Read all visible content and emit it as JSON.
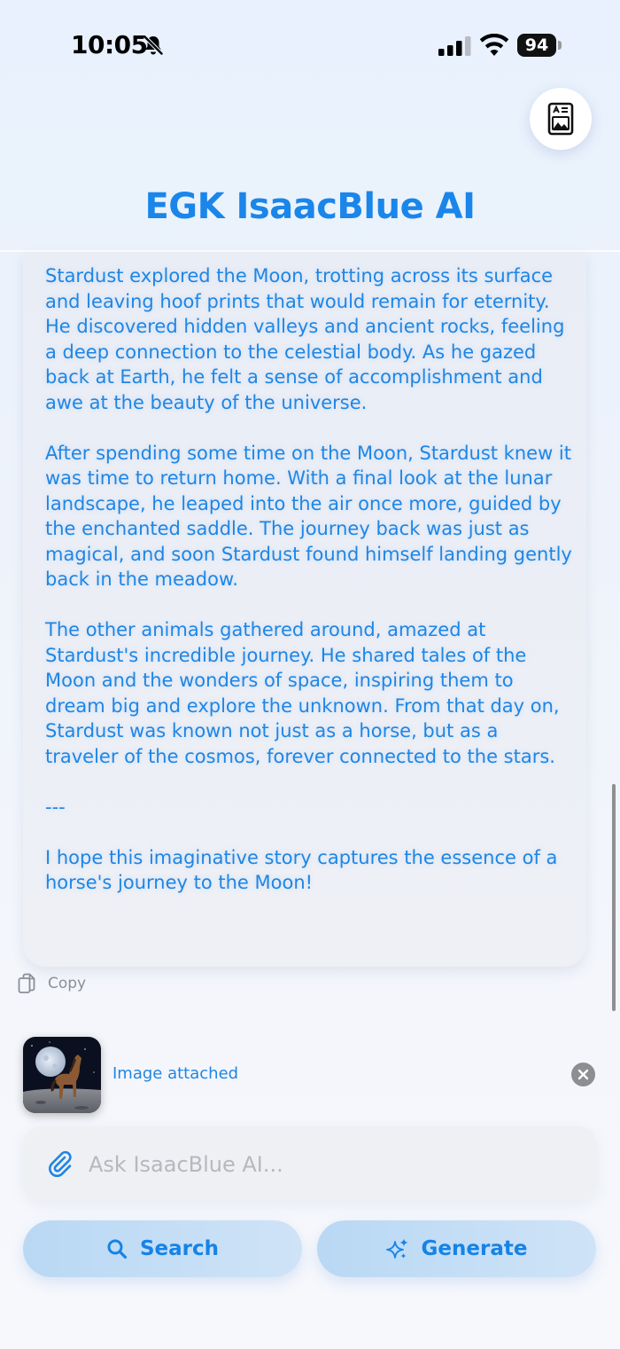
{
  "status_bar": {
    "time": "10:05",
    "battery": "94"
  },
  "header": {
    "title": "EGK IsaacBlue AI",
    "gallery_icon": "image-document-icon"
  },
  "message": {
    "paragraphs": [
      "Stardust explored the Moon, trotting across its surface and leaving hoof prints that would remain for eternity. He discovered hidden valleys and ancient rocks, feeling a deep connection to the celestial body. As he gazed back at Earth, he felt a sense of accomplishment and awe at the beauty of the universe.",
      "After spending some time on the Moon, Stardust knew it was time to return home. With a final look at the lunar landscape, he leaped into the air once more, guided by the enchanted saddle. The journey back was just as magical, and soon Stardust found himself landing gently back in the meadow.",
      "The other animals gathered around, amazed at Stardust's incredible journey. He shared tales of the Moon and the wonders of space, inspiring them to dream big and explore the unknown. From that day on, Stardust was known not just as a horse, but as a traveler of the cosmos, forever connected to the stars.",
      "---",
      "I hope this imaginative story captures the essence of a horse's journey to the Moon!"
    ],
    "copy_label": "Copy"
  },
  "attachment": {
    "label": "Image attached"
  },
  "input": {
    "placeholder": "Ask IsaacBlue AI..."
  },
  "actions": {
    "search_label": "Search",
    "generate_label": "Generate"
  },
  "colors": {
    "accent": "#1a86ea",
    "button_bg": "#c3ddf5",
    "card_bg": "#eceff6"
  }
}
